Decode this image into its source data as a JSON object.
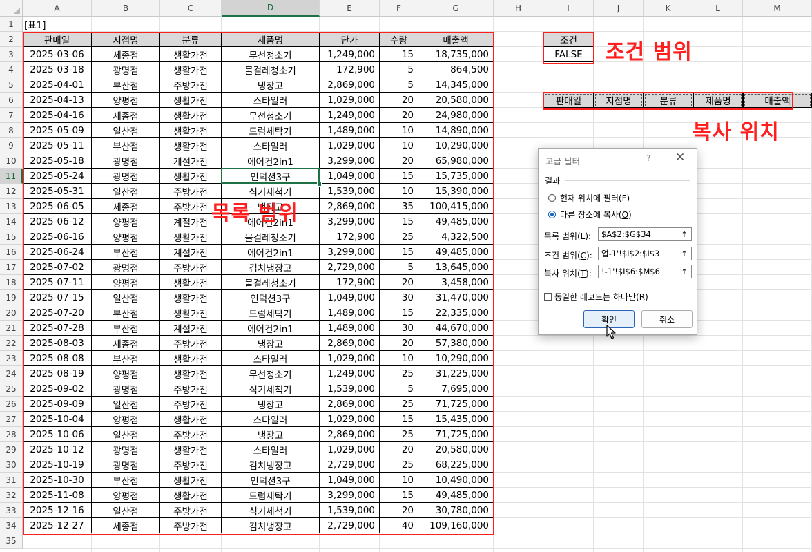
{
  "columns": [
    "A",
    "B",
    "C",
    "D",
    "E",
    "F",
    "G",
    "H",
    "I",
    "J",
    "K",
    "L",
    "M"
  ],
  "rows": [
    "1",
    "2",
    "3",
    "4",
    "5",
    "6",
    "7",
    "8",
    "9",
    "10",
    "11",
    "12",
    "13",
    "14",
    "15",
    "16",
    "17",
    "18",
    "19",
    "20",
    "21",
    "22",
    "23",
    "24",
    "25",
    "26",
    "27",
    "28",
    "29",
    "30",
    "31",
    "32",
    "33",
    "34",
    "35"
  ],
  "selected_cell": {
    "column": "D",
    "row": "11"
  },
  "table_title": "[표1]",
  "table": {
    "headers": [
      "판매일",
      "지점명",
      "분류",
      "제품명",
      "단가",
      "수량",
      "매출액"
    ],
    "rows": [
      [
        "2025-03-06",
        "세종점",
        "생활가전",
        "무선청소기",
        "1,249,000",
        "15",
        "18,735,000"
      ],
      [
        "2025-03-18",
        "광명점",
        "생활가전",
        "물걸레청소기",
        "172,900",
        "5",
        "864,500"
      ],
      [
        "2025-04-01",
        "부산점",
        "주방가전",
        "냉장고",
        "2,869,000",
        "5",
        "14,345,000"
      ],
      [
        "2025-04-13",
        "양평점",
        "생활가전",
        "스타일러",
        "1,029,000",
        "20",
        "20,580,000"
      ],
      [
        "2025-04-16",
        "세종점",
        "생활가전",
        "무선청소기",
        "1,249,000",
        "20",
        "24,980,000"
      ],
      [
        "2025-05-09",
        "일산점",
        "생활가전",
        "드럼세탁기",
        "1,489,000",
        "10",
        "14,890,000"
      ],
      [
        "2025-05-11",
        "부산점",
        "생활가전",
        "스타일러",
        "1,029,000",
        "10",
        "10,290,000"
      ],
      [
        "2025-05-18",
        "광명점",
        "계절가전",
        "에어컨2in1",
        "3,299,000",
        "20",
        "65,980,000"
      ],
      [
        "2025-05-24",
        "광명점",
        "생활가전",
        "인덕션3구",
        "1,049,000",
        "15",
        "15,735,000"
      ],
      [
        "2025-05-31",
        "일산점",
        "주방가전",
        "식기세척기",
        "1,539,000",
        "10",
        "15,390,000"
      ],
      [
        "2025-06-05",
        "세종점",
        "주방가전",
        "냉장고",
        "2,869,000",
        "35",
        "100,415,000"
      ],
      [
        "2025-06-12",
        "양평점",
        "계절가전",
        "에어컨2in1",
        "3,299,000",
        "15",
        "49,485,000"
      ],
      [
        "2025-06-16",
        "양평점",
        "생활가전",
        "물걸레청소기",
        "172,900",
        "25",
        "4,322,500"
      ],
      [
        "2025-06-24",
        "부산점",
        "계절가전",
        "에어컨2in1",
        "3,299,000",
        "15",
        "49,485,000"
      ],
      [
        "2025-07-02",
        "광명점",
        "주방가전",
        "김치냉장고",
        "2,729,000",
        "5",
        "13,645,000"
      ],
      [
        "2025-07-11",
        "양평점",
        "생활가전",
        "물걸레청소기",
        "172,900",
        "20",
        "3,458,000"
      ],
      [
        "2025-07-15",
        "일산점",
        "생활가전",
        "인덕션3구",
        "1,049,000",
        "30",
        "31,470,000"
      ],
      [
        "2025-07-20",
        "부산점",
        "생활가전",
        "드럼세탁기",
        "1,489,000",
        "15",
        "22,335,000"
      ],
      [
        "2025-07-28",
        "부산점",
        "계절가전",
        "에어컨2in1",
        "1,489,000",
        "30",
        "44,670,000"
      ],
      [
        "2025-08-03",
        "세종점",
        "주방가전",
        "냉장고",
        "2,869,000",
        "20",
        "57,380,000"
      ],
      [
        "2025-08-08",
        "부산점",
        "생활가전",
        "스타일러",
        "1,029,000",
        "10",
        "10,290,000"
      ],
      [
        "2025-08-19",
        "양평점",
        "생활가전",
        "무선청소기",
        "1,249,000",
        "25",
        "31,225,000"
      ],
      [
        "2025-09-02",
        "광명점",
        "주방가전",
        "식기세척기",
        "1,539,000",
        "5",
        "7,695,000"
      ],
      [
        "2025-09-09",
        "일산점",
        "주방가전",
        "냉장고",
        "2,869,000",
        "25",
        "71,725,000"
      ],
      [
        "2025-10-04",
        "양평점",
        "생활가전",
        "스타일러",
        "1,029,000",
        "15",
        "15,435,000"
      ],
      [
        "2025-10-06",
        "일산점",
        "주방가전",
        "냉장고",
        "2,869,000",
        "25",
        "71,725,000"
      ],
      [
        "2025-10-12",
        "광명점",
        "생활가전",
        "스타일러",
        "1,029,000",
        "20",
        "20,580,000"
      ],
      [
        "2025-10-19",
        "광명점",
        "주방가전",
        "김치냉장고",
        "2,729,000",
        "25",
        "68,225,000"
      ],
      [
        "2025-10-30",
        "부산점",
        "생활가전",
        "인덕션3구",
        "1,049,000",
        "10",
        "10,490,000"
      ],
      [
        "2025-11-08",
        "양평점",
        "생활가전",
        "드럼세탁기",
        "3,299,000",
        "15",
        "49,485,000"
      ],
      [
        "2025-12-16",
        "일산점",
        "주방가전",
        "식기세척기",
        "1,539,000",
        "20",
        "30,780,000"
      ],
      [
        "2025-12-27",
        "세종점",
        "주방가전",
        "김치냉장고",
        "2,729,000",
        "40",
        "109,160,000"
      ]
    ]
  },
  "criteria": {
    "header": "조건",
    "value": "FALSE"
  },
  "copy_headers": [
    "판매일",
    "지점명",
    "분류",
    "제품명",
    "매출액"
  ],
  "annotations": {
    "list_range": "목록 범위",
    "criteria_range": "조건 범위",
    "copy_to": "복사 위치"
  },
  "colors": {
    "annotation_red": "#ff1f1f",
    "header_gray": "#d9d9d9",
    "selection_green": "#1e7145"
  },
  "dialog": {
    "title": "고급 필터",
    "help": "?",
    "close": "✕",
    "section": "결과",
    "radio_in_place_text": "현재 위치에 필터(",
    "radio_in_place_key": "F",
    "radio_copy_text": "다른 장소에 복사(",
    "radio_copy_key": "O",
    "radio_selected": "copy",
    "list_label_text": "목록 범위(",
    "list_label_key": "L",
    "list_value": "$A$2:$G$34",
    "criteria_label_text": "조건 범위(",
    "criteria_label_key": "C",
    "criteria_value": "업-1'!$I$2:$I$3",
    "copy_label_text": "복사 위치(",
    "copy_label_key": "T",
    "copy_value": "!-1'!$I$6:$M$6",
    "unique_text": "동일한 레코드는 하나만(",
    "unique_key": "R",
    "unique_checked": false,
    "ok": "확인",
    "cancel": "취소",
    "collapse_icon": "↑"
  }
}
